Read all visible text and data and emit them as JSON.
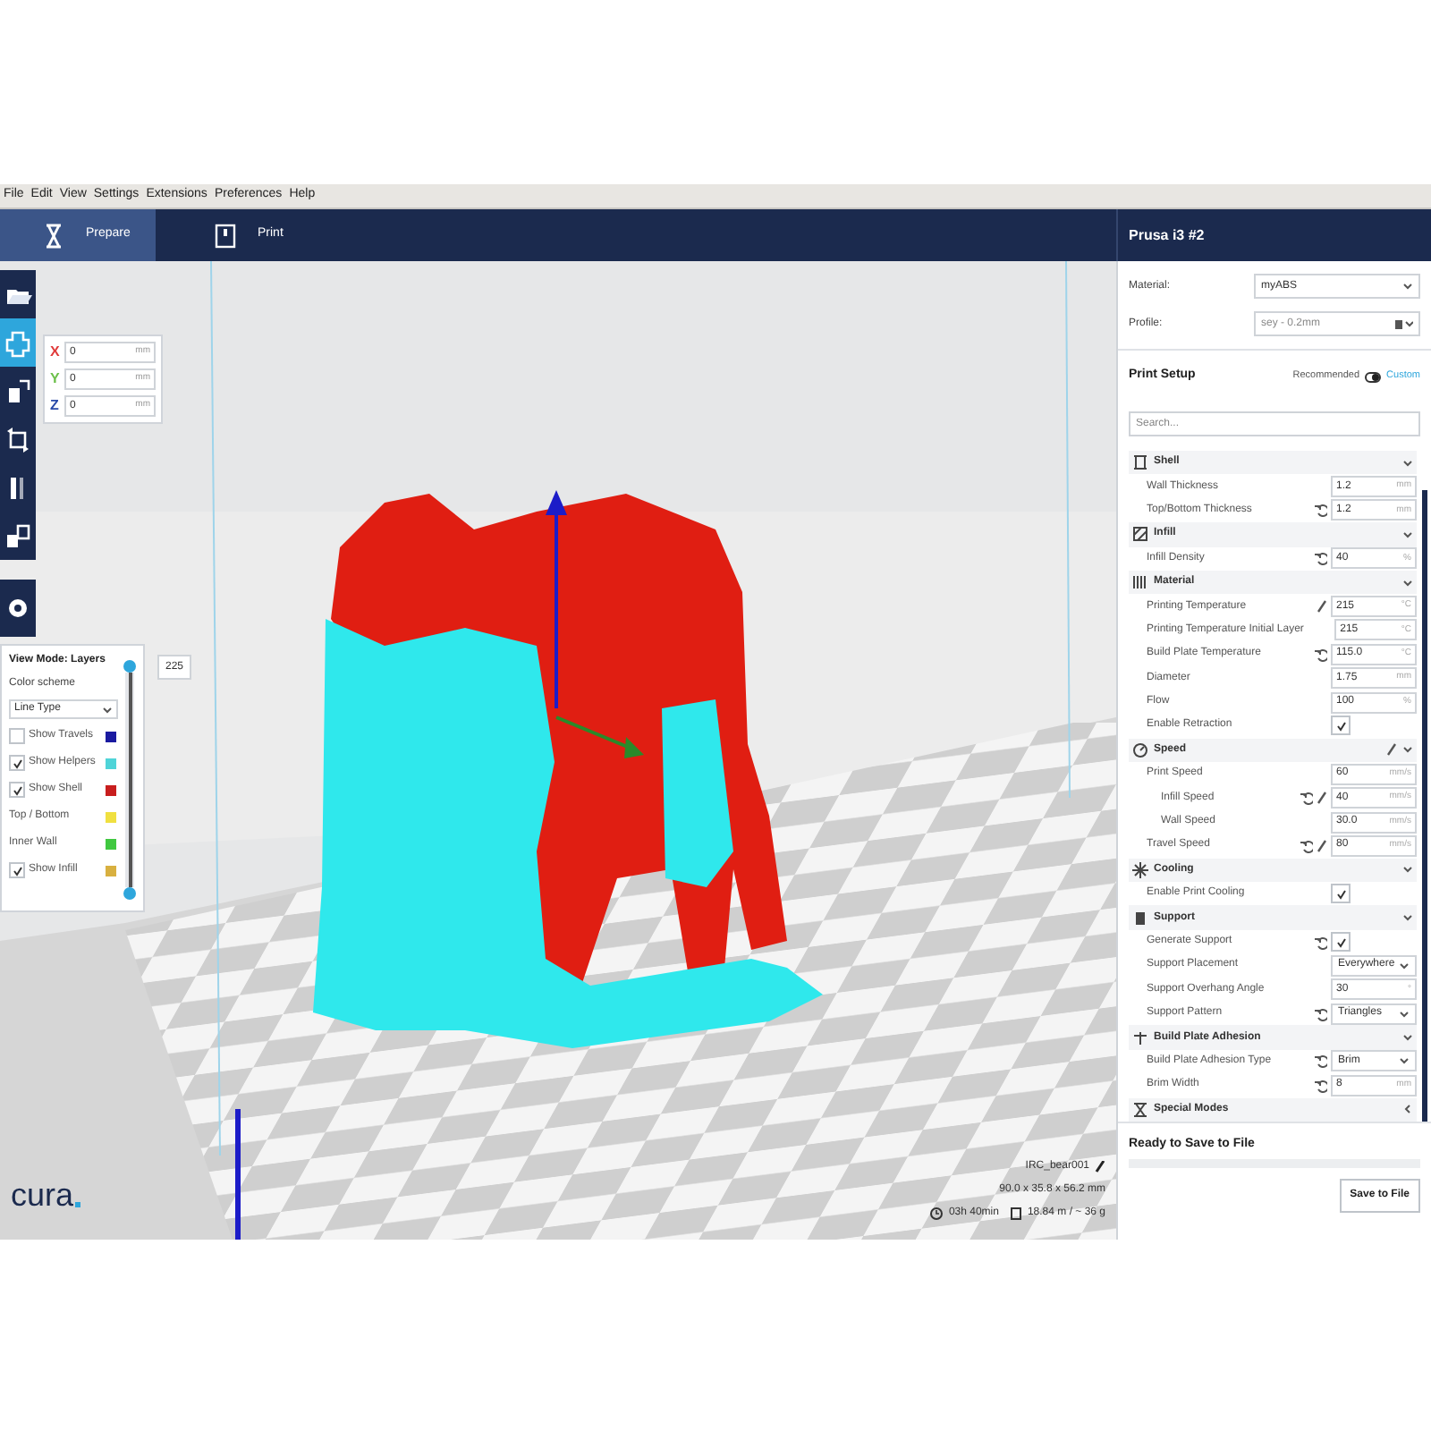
{
  "menu": [
    "File",
    "Edit",
    "View",
    "Settings",
    "Extensions",
    "Preferences",
    "Help"
  ],
  "stages": [
    {
      "label": "Prepare",
      "kind": "prepare",
      "selected": true
    },
    {
      "label": "Print",
      "kind": "print",
      "selected": false
    }
  ],
  "printer": "Prusa i3 #2",
  "tools": [
    {
      "kind": "open",
      "selected": false
    },
    {
      "kind": "move",
      "selected": true
    },
    {
      "kind": "scale",
      "selected": false
    },
    {
      "kind": "rotate",
      "selected": false
    },
    {
      "kind": "mirror",
      "selected": false
    },
    {
      "kind": "per-model",
      "selected": false
    }
  ],
  "move_panel": {
    "fields": [
      {
        "axis": "X",
        "value": "0",
        "unit": "mm",
        "color": "#e03a3a"
      },
      {
        "axis": "Y",
        "value": "0",
        "unit": "mm",
        "color": "#6cc04a"
      },
      {
        "axis": "Z",
        "value": "0",
        "unit": "mm",
        "color": "#2a4aa8"
      }
    ]
  },
  "view_panel": {
    "title": "View Mode: Layers",
    "color_scheme_label": "Color scheme",
    "color_scheme": "Line Type",
    "layer": "225",
    "slider": {
      "level": 1
    },
    "items": [
      {
        "kind": "checkbox",
        "label": "Show Travels",
        "checked": false,
        "color": "#1a1aa0"
      },
      {
        "kind": "checkbox",
        "label": "Show Helpers",
        "checked": true,
        "color": "#4fd4d8"
      },
      {
        "kind": "checkbox",
        "label": "Show Shell",
        "checked": true,
        "color": "#c81e1e"
      },
      {
        "kind": "plain",
        "label": "Top / Bottom",
        "color": "#f0e040"
      },
      {
        "kind": "plain",
        "label": "Inner Wall",
        "color": "#40c840"
      },
      {
        "kind": "checkbox",
        "label": "Show Infill",
        "checked": true,
        "color": "#d8b040"
      }
    ]
  },
  "logo": "cura",
  "model_info": {
    "name": "IRC_bear001",
    "dimensions": "90.0 x 35.8 x 56.2 mm",
    "time": "03h 40min",
    "material": "18.84 m / ~ 36 g"
  },
  "sidebar": {
    "material_label": "Material:",
    "material": "myABS",
    "profile_label": "Profile:",
    "profile": "sey - 0.2mm",
    "setup_title": "Print Setup",
    "modes": [
      {
        "label": "Recommended",
        "selected": false
      },
      {
        "label": "Custom",
        "selected": true
      }
    ],
    "search_placeholder": "Search...",
    "categories": [
      {
        "kind": "shell",
        "label": "Shell",
        "expanded": true,
        "linked": false,
        "settings": [
          {
            "kind": "number",
            "label": "Wall Thickness",
            "value": "1.2",
            "unit": "mm",
            "reset": false,
            "linked": false
          },
          {
            "kind": "number",
            "label": "Top/Bottom Thickness",
            "value": "1.2",
            "unit": "mm",
            "reset": true,
            "linked": false
          }
        ]
      },
      {
        "kind": "infill",
        "label": "Infill",
        "expanded": true,
        "linked": false,
        "settings": [
          {
            "kind": "number",
            "label": "Infill Density",
            "value": "40",
            "unit": "%",
            "reset": true,
            "linked": false
          }
        ]
      },
      {
        "kind": "material",
        "label": "Material",
        "expanded": true,
        "linked": false,
        "settings": [
          {
            "kind": "number",
            "label": "Printing Temperature",
            "value": "215",
            "unit": "°C",
            "reset": false,
            "linked": true
          },
          {
            "kind": "number",
            "label": "Printing Temperature Initial Layer",
            "value": "215",
            "unit": "°C",
            "reset": false,
            "linked": false
          },
          {
            "kind": "number",
            "label": "Build Plate Temperature",
            "value": "115.0",
            "unit": "°C",
            "reset": true,
            "linked": false
          },
          {
            "kind": "number",
            "label": "Diameter",
            "value": "1.75",
            "unit": "mm",
            "reset": false,
            "linked": false
          },
          {
            "kind": "number",
            "label": "Flow",
            "value": "100",
            "unit": "%",
            "reset": false,
            "linked": false
          },
          {
            "kind": "checkbox",
            "label": "Enable Retraction",
            "checked": true,
            "reset": false,
            "linked": false
          }
        ]
      },
      {
        "kind": "speed",
        "label": "Speed",
        "expanded": true,
        "linked": true,
        "settings": [
          {
            "kind": "number",
            "label": "Print Speed",
            "value": "60",
            "unit": "mm/s",
            "reset": false,
            "linked": false,
            "children": [
              {
                "kind": "number",
                "label": "Infill Speed",
                "value": "40",
                "unit": "mm/s",
                "reset": true,
                "linked": true
              },
              {
                "kind": "number",
                "label": "Wall Speed",
                "value": "30.0",
                "unit": "mm/s",
                "reset": false,
                "linked": false
              }
            ]
          },
          {
            "kind": "number",
            "label": "Travel Speed",
            "value": "80",
            "unit": "mm/s",
            "reset": true,
            "linked": true
          }
        ]
      },
      {
        "kind": "cooling",
        "label": "Cooling",
        "expanded": true,
        "linked": false,
        "settings": [
          {
            "kind": "checkbox",
            "label": "Enable Print Cooling",
            "checked": true,
            "reset": false,
            "linked": false
          }
        ]
      },
      {
        "kind": "support",
        "label": "Support",
        "expanded": true,
        "linked": false,
        "settings": [
          {
            "kind": "checkbox",
            "label": "Generate Support",
            "checked": true,
            "reset": true,
            "linked": false
          },
          {
            "kind": "dropdown",
            "label": "Support Placement",
            "value": "Everywhere",
            "reset": false,
            "linked": false
          },
          {
            "kind": "number",
            "label": "Support Overhang Angle",
            "value": "30",
            "unit": "°",
            "reset": false,
            "linked": false
          },
          {
            "kind": "dropdown",
            "label": "Support Pattern",
            "value": "Triangles",
            "reset": true,
            "linked": false
          }
        ]
      },
      {
        "kind": "adhesion",
        "label": "Build Plate Adhesion",
        "expanded": true,
        "linked": false,
        "settings": [
          {
            "kind": "dropdown",
            "label": "Build Plate Adhesion Type",
            "value": "Brim",
            "reset": true,
            "linked": false
          },
          {
            "kind": "number",
            "label": "Brim Width",
            "value": "8",
            "unit": "mm",
            "reset": true,
            "linked": false
          }
        ]
      },
      {
        "kind": "special",
        "label": "Special Modes",
        "expanded": false,
        "linked": false
      }
    ],
    "status": "Ready to Save to File",
    "progress": {
      "level": 0
    },
    "save_button": "Save to File"
  }
}
